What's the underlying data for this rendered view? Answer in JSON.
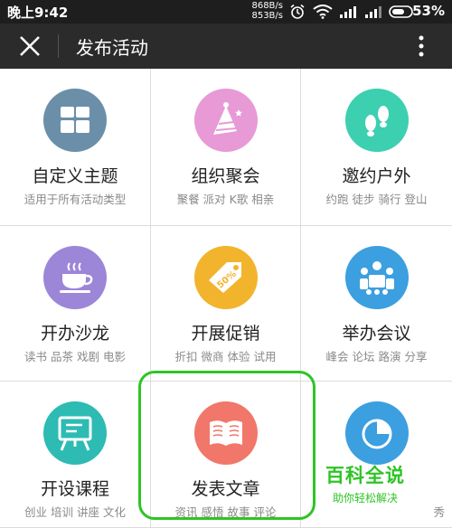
{
  "status_bar": {
    "time": "晚上9:42",
    "net_up": "868B/s",
    "net_down": "853B/s",
    "battery": "53%",
    "icons": [
      "alarm-icon",
      "wifi-icon",
      "signal-icon",
      "battery-icon"
    ]
  },
  "title_bar": {
    "title": "发布活动"
  },
  "grid": [
    {
      "name": "自定义主题",
      "sub": "适用于所有活动类型",
      "color": "#6b8fa8",
      "icon": "grid-icon"
    },
    {
      "name": "组织聚会",
      "sub": "聚餐 派对 K歌 相亲",
      "color": "#e79ad6",
      "icon": "party-hat-icon"
    },
    {
      "name": "邀约户外",
      "sub": "约跑 徒步 骑行 登山",
      "color": "#3ccfb0",
      "icon": "footprints-icon"
    },
    {
      "name": "开办沙龙",
      "sub": "读书 品茶 戏剧 电影",
      "color": "#9b86d8",
      "icon": "coffee-cup-icon"
    },
    {
      "name": "开展促销",
      "sub": "折扣 微商 体验 试用",
      "color": "#f2b42c",
      "icon": "discount-tag-icon"
    },
    {
      "name": "举办会议",
      "sub": "峰会 论坛 路演 分享",
      "color": "#3b9fe0",
      "icon": "meeting-icon"
    },
    {
      "name": "开设课程",
      "sub": "创业 培训 讲座 文化",
      "color": "#2dbbb3",
      "icon": "blackboard-icon"
    },
    {
      "name": "发表文章",
      "sub": "资讯 感悟 故事 评论",
      "color": "#f0776a",
      "icon": "open-book-icon"
    },
    {
      "name": "",
      "sub": "秀",
      "color": "#3b9fe0",
      "icon": "pie-chart-icon"
    }
  ],
  "watermark": {
    "line1": "百科全说",
    "line2": "助你轻松解决"
  }
}
